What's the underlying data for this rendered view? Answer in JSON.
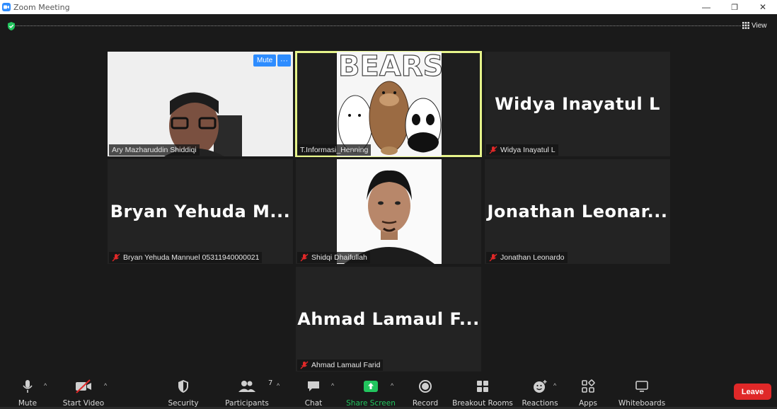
{
  "window": {
    "title": "Zoom Meeting",
    "minimize": "—",
    "restore": "❐",
    "close": "✕"
  },
  "top": {
    "view_label": "View"
  },
  "tiles": [
    {
      "name": "Ary Mazharuddin Shiddiqi",
      "mute_btn": "Mute",
      "more_btn": "···"
    },
    {
      "name": "T.Informasi_Henning",
      "image_text": "BEARS"
    },
    {
      "name": "Widya Inayatul L",
      "display_name": "Widya Inayatul L"
    },
    {
      "name": "Bryan Yehuda Mannuel 05311940000021",
      "display_name": "Bryan Yehuda M..."
    },
    {
      "name": "Shidqi Dhaifullah"
    },
    {
      "name": "Jonathan Leonardo",
      "display_name": "Jonathan Leonar..."
    },
    {
      "name": "Ahmad Lamaul Farid",
      "display_name": "Ahmad Lamaul F..."
    }
  ],
  "toolbar": {
    "mute": "Mute",
    "start_video": "Start Video",
    "security": "Security",
    "participants": "Participants",
    "participants_count": "7",
    "chat": "Chat",
    "share_screen": "Share Screen",
    "record": "Record",
    "breakout_rooms": "Breakout Rooms",
    "reactions": "Reactions",
    "apps": "Apps",
    "whiteboards": "Whiteboards",
    "leave": "Leave"
  },
  "colors": {
    "accent": "#2d8cff",
    "active_speaker": "#e6f48a",
    "leave": "#e02828",
    "share": "#22c55e"
  }
}
